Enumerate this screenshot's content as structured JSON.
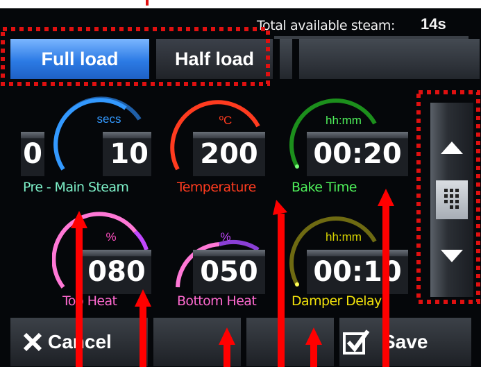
{
  "header": {
    "steam_label": "Total available steam:",
    "steam_value": "14s"
  },
  "tabs": [
    {
      "label": "Full load",
      "active": true
    },
    {
      "label": "Half load",
      "active": false
    }
  ],
  "gauges": [
    {
      "unit": "secs",
      "values": [
        "0",
        "10"
      ],
      "label": "Pre - Main Steam",
      "color": "#3399ff",
      "label_color": "#7df0c8"
    },
    {
      "unit": "ºC",
      "values": [
        "200"
      ],
      "label": "Temperature",
      "color": "#ff3b1f",
      "label_color": "#ff3b1f"
    },
    {
      "unit": "hh:mm",
      "values": [
        "00:20"
      ],
      "label": "Bake Time",
      "color": "#22bb22",
      "label_color": "#4ef05a"
    },
    {
      "unit": "%",
      "values": [
        "080"
      ],
      "label": "Top Heat",
      "color": "#ff4fc0",
      "label_color": "#ff6ad0"
    },
    {
      "unit": "%",
      "values": [
        "050"
      ],
      "label": "Bottom Heat",
      "color": "#c248ff",
      "label_color": "#ff6ad0"
    },
    {
      "unit": "hh:mm",
      "values": [
        "00:10"
      ],
      "label": "Damper Delay",
      "color": "#d7d300",
      "label_color": "#f2e20a"
    }
  ],
  "footer": {
    "cancel_label": "Cancel",
    "save_label": "Save"
  },
  "icons": {
    "up": "arrow-up-icon",
    "down": "arrow-down-icon",
    "grip": "keypad-icon",
    "cancel": "x-icon",
    "save": "checkbox-icon"
  },
  "colors": {
    "active_tab": "#2c7be5",
    "annotation": "#e01010"
  }
}
